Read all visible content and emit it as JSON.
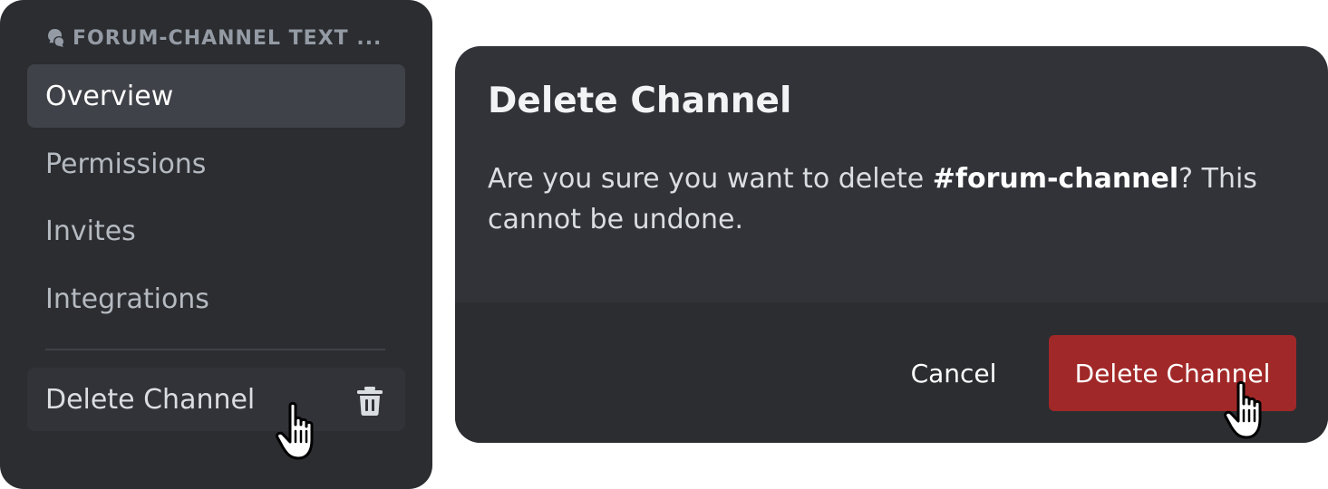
{
  "sidebar": {
    "header": "FORUM-CHANNEL TEXT ...",
    "header_icon": "forum-icon",
    "items": [
      {
        "label": "Overview",
        "active": true
      },
      {
        "label": "Permissions",
        "active": false
      },
      {
        "label": "Invites",
        "active": false
      },
      {
        "label": "Integrations",
        "active": false
      }
    ],
    "danger_item": {
      "label": "Delete Channel",
      "icon": "trash-icon"
    }
  },
  "dialog": {
    "title": "Delete Channel",
    "body_prefix": "Are you sure you want to delete ",
    "channel_name": "#forum-channel",
    "body_suffix": "? This cannot be undone.",
    "cancel_label": "Cancel",
    "confirm_label": "Delete Channel"
  },
  "colors": {
    "sidebar_bg": "#2b2d31",
    "dialog_bg": "#313338",
    "active_item_bg": "#404249",
    "danger_button": "#a12828"
  }
}
